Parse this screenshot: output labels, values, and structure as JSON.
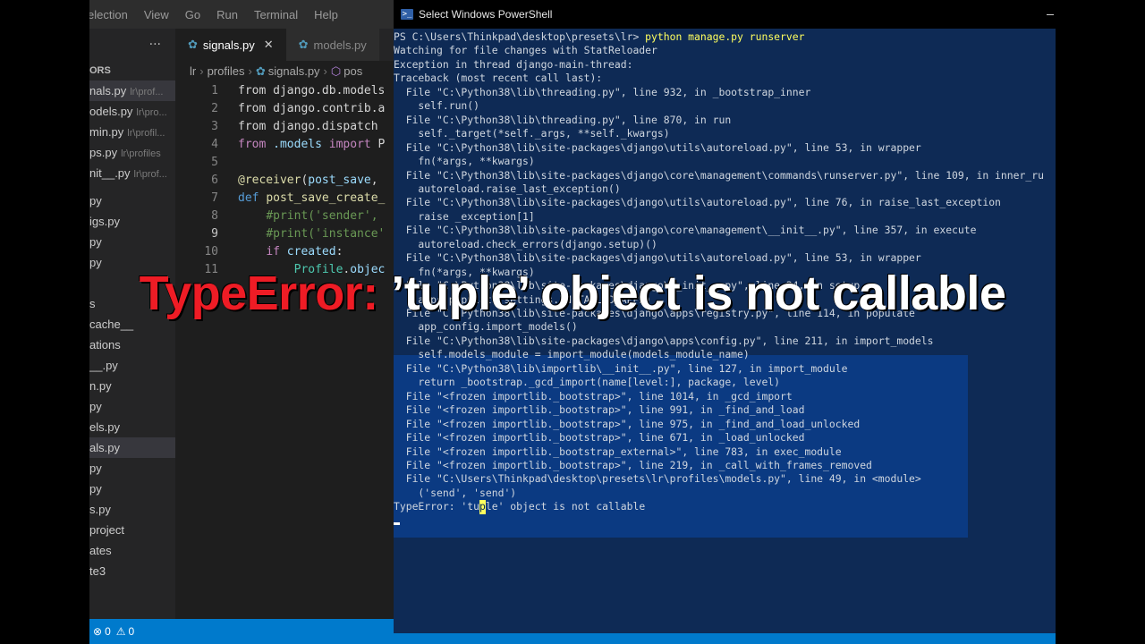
{
  "vscode": {
    "menu": [
      "election",
      "View",
      "Go",
      "Run",
      "Terminal",
      "Help"
    ],
    "sidebar": {
      "more": "···",
      "section": "ORS",
      "open_editors": [
        {
          "name": "nals.py",
          "path": "lr\\prof..."
        },
        {
          "name": "odels.py",
          "path": "lr\\pro..."
        },
        {
          "name": "min.py",
          "path": "lr\\profil..."
        },
        {
          "name": "ps.py",
          "path": "lr\\profiles"
        },
        {
          "name": "nit__.py",
          "path": "lr\\prof..."
        }
      ],
      "tree": [
        "py",
        "igs.py",
        "py",
        "py",
        "",
        "s",
        "cache__",
        "ations",
        "__.py",
        "n.py",
        "py",
        "els.py",
        "als.py",
        "py",
        "py",
        "s.py",
        "project",
        "ates",
        "te3"
      ]
    },
    "tabs": [
      {
        "label": "signals.py",
        "active": true
      },
      {
        "label": "models.py",
        "active": false
      }
    ],
    "breadcrumb": [
      "lr",
      "profiles",
      "signals.py",
      "pos"
    ],
    "code_lines": [
      {
        "n": "1",
        "text": "from django.db.models"
      },
      {
        "n": "2",
        "text": "from django.contrib.a"
      },
      {
        "n": "3",
        "text": "from django.dispatch"
      },
      {
        "n": "4",
        "text": "from .models import P"
      },
      {
        "n": "5",
        "text": ""
      },
      {
        "n": "6",
        "text": "@receiver(post_save, "
      },
      {
        "n": "7",
        "text": "def post_save_create_"
      },
      {
        "n": "8",
        "text": "    #print('sender',"
      },
      {
        "n": "9",
        "text": "    #print('instance'"
      },
      {
        "n": "10",
        "text": "    if created:"
      },
      {
        "n": "11",
        "text": "        Profile.objec"
      }
    ],
    "status": {
      "errors": "0",
      "warnings": "0"
    }
  },
  "powershell": {
    "title": "Select Windows PowerShell",
    "prompt": "PS C:\\Users\\Thinkpad\\desktop\\presets\\lr> ",
    "command": "python manage.py runserver",
    "lines": [
      "Watching for file changes with StatReloader",
      "Exception in thread django-main-thread:",
      "Traceback (most recent call last):",
      "  File \"C:\\Python38\\lib\\threading.py\", line 932, in _bootstrap_inner",
      "    self.run()",
      "  File \"C:\\Python38\\lib\\threading.py\", line 870, in run",
      "    self._target(*self._args, **self._kwargs)",
      "  File \"C:\\Python38\\lib\\site-packages\\django\\utils\\autoreload.py\", line 53, in wrapper",
      "    fn(*args, **kwargs)",
      "  File \"C:\\Python38\\lib\\site-packages\\django\\core\\management\\commands\\runserver.py\", line 109, in inner_ru",
      "    autoreload.raise_last_exception()",
      "  File \"C:\\Python38\\lib\\site-packages\\django\\utils\\autoreload.py\", line 76, in raise_last_exception",
      "    raise _exception[1]",
      "  File \"C:\\Python38\\lib\\site-packages\\django\\core\\management\\__init__.py\", line 357, in execute",
      "    autoreload.check_errors(django.setup)()",
      "  File \"C:\\Python38\\lib\\site-packages\\django\\utils\\autoreload.py\", line 53, in wrapper",
      "    fn(*args, **kwargs)",
      "  File \"C:\\Python38\\lib\\site-packages\\django\\__init__.py\", line 24, in setup",
      "    apps.populate(settings.INSTALLED_APPS)",
      "  File \"C:\\Python38\\lib\\site-packages\\django\\apps\\registry.py\", line 114, in populate",
      "    app_config.import_models()",
      "  File \"C:\\Python38\\lib\\site-packages\\django\\apps\\config.py\", line 211, in import_models",
      "    self.models_module = import_module(models_module_name)",
      "  File \"C:\\Python38\\lib\\importlib\\__init__.py\", line 127, in import_module",
      "    return _bootstrap._gcd_import(name[level:], package, level)",
      "  File \"<frozen importlib._bootstrap>\", line 1014, in _gcd_import",
      "  File \"<frozen importlib._bootstrap>\", line 991, in _find_and_load",
      "  File \"<frozen importlib._bootstrap>\", line 975, in _find_and_load_unlocked",
      "  File \"<frozen importlib._bootstrap>\", line 671, in _load_unlocked",
      "  File \"<frozen importlib._bootstrap_external>\", line 783, in exec_module",
      "  File \"<frozen importlib._bootstrap>\", line 219, in _call_with_frames_removed",
      "  File \"C:\\Users\\Thinkpad\\desktop\\presets\\lr\\profiles\\models.py\", line 49, in <module>",
      "    ('send', 'send')"
    ],
    "error_line": {
      "before": "TypeError: 'tu",
      "caret": "p",
      "after": "le' object is not callable"
    }
  },
  "overlay": {
    "red": "TypeError:",
    "white": " ’tuple’ object is not callable"
  },
  "colors": {
    "ps_background": "#012456",
    "overlay_red": "#ee1c25",
    "statusbar": "#007acc"
  }
}
